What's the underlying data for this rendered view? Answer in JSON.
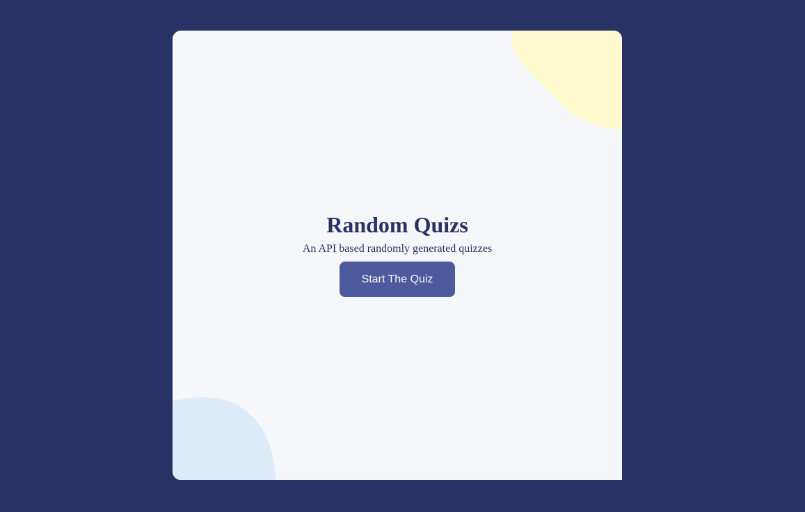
{
  "app": {
    "title": "Random Quizs",
    "subtitle": "An API based randomly generated quizzes",
    "start_button_label": "Start The Quiz"
  },
  "colors": {
    "page_background": "#293264",
    "card_background": "#F5F7FB",
    "title_text": "#293264",
    "button_background": "#4D5B9E",
    "button_text": "#F5F7FB",
    "blob_yellow": "#FFFACF",
    "blob_blue": "#DEEBF8"
  }
}
